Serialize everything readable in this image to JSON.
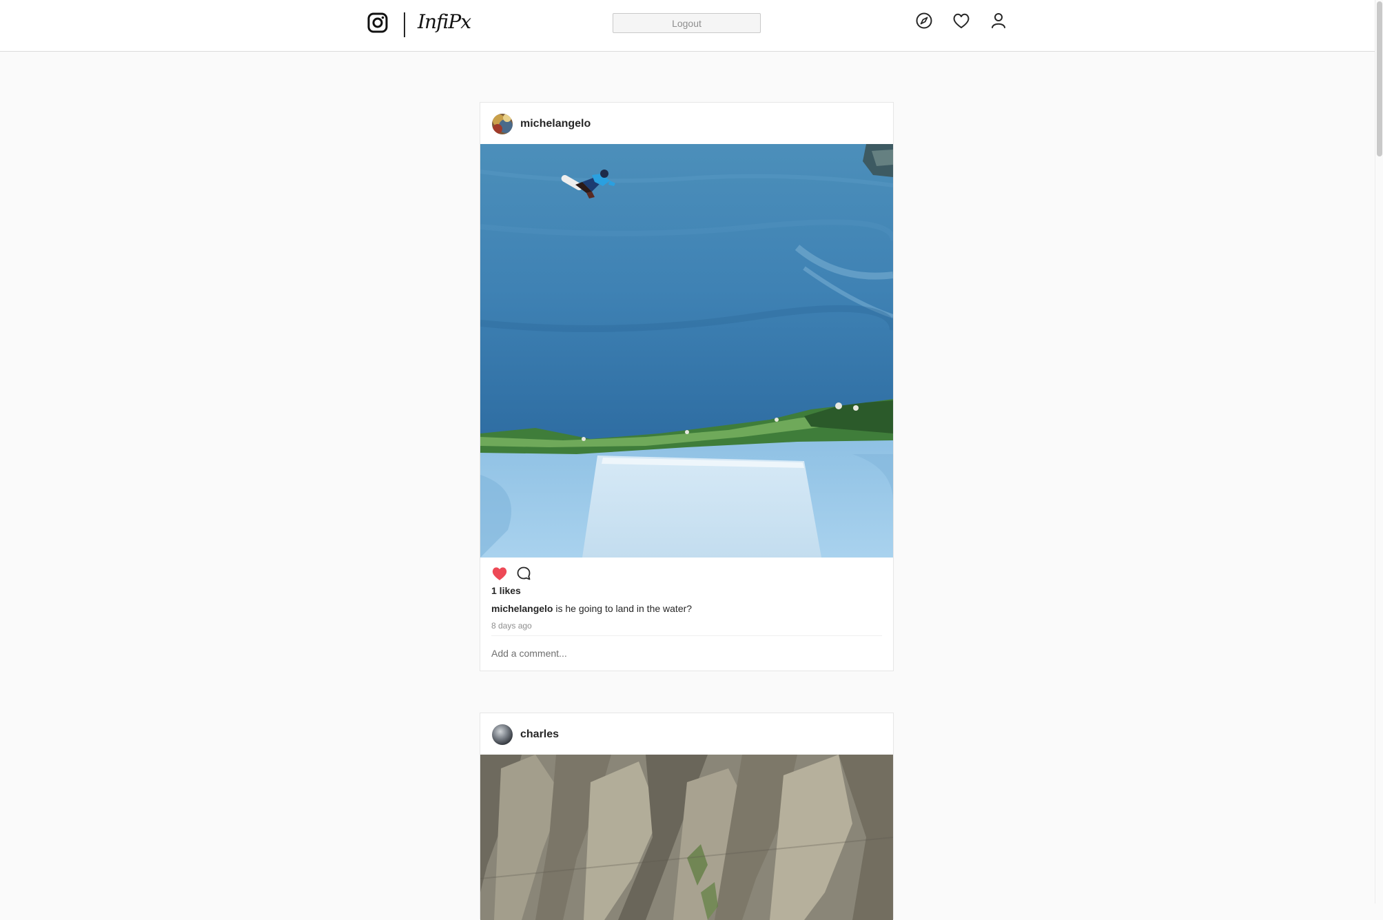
{
  "header": {
    "wordmark": "InfiPx",
    "logout_label": "Logout",
    "icons": [
      "instagram-icon",
      "compass-icon",
      "heart-icon",
      "user-icon"
    ]
  },
  "posts": [
    {
      "username": "michelangelo",
      "likes": "1 likes",
      "caption_user": "michelangelo",
      "caption_text": " is he going to land in the water?",
      "time": "8 days ago",
      "comment_placeholder": "Add a comment...",
      "liked": true
    },
    {
      "username": "charles"
    }
  ],
  "colors": {
    "like_red": "#ed4956",
    "border": "#dbdbdb",
    "background": "#fafafa"
  }
}
